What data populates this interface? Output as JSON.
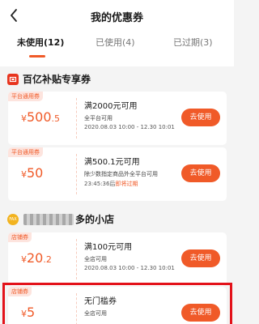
{
  "header": {
    "title": "我的优惠券",
    "tabs": [
      {
        "label": "未使用(12)",
        "active": true
      },
      {
        "label": "已使用(4)",
        "active": false
      },
      {
        "label": "已过期(3)",
        "active": false
      }
    ]
  },
  "sections": [
    {
      "title": "百亿补贴专享券",
      "icon": "coupon-badge-icon"
    },
    {
      "title": "多的小店",
      "icon": "store-icon",
      "icon_text": "FAX",
      "blurred_prefix": true
    }
  ],
  "coupons": [
    {
      "tag": "平台通用券",
      "currency": "¥",
      "amount_int": "500",
      "amount_dec": ".5",
      "name": "满2000元可用",
      "scope": "全平台可用",
      "period": "2020.08.03 10:00 - 12.30 10:01",
      "period_warn": "",
      "button": "去使用"
    },
    {
      "tag": "平台通用券",
      "currency": "¥",
      "amount_int": "50",
      "amount_dec": "",
      "name": "满500.1元可用",
      "scope": "除少数指定商品外全平台可用",
      "period": "23:45:36后",
      "period_warn": "即将过期",
      "button": "去使用"
    },
    {
      "tag": "店铺券",
      "currency": "¥",
      "amount_int": "20",
      "amount_dec": ".2",
      "name": "满100元可用",
      "scope": "全店可用",
      "period": "2020.08.03 10:00 - 12.30 10:01",
      "period_warn": "",
      "button": "去使用"
    },
    {
      "tag": "店铺券",
      "currency": "¥",
      "amount_int": "5",
      "amount_dec": "",
      "name": "无门槛券",
      "scope": "全店可用",
      "period": "",
      "period_warn": "",
      "button": "去使用"
    }
  ],
  "colors": {
    "accent": "#f05a28",
    "highlight": "#e3121a",
    "background": "#f4f4f4"
  }
}
